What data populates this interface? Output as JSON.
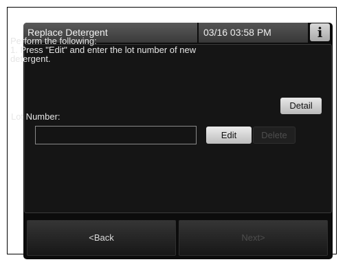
{
  "titlebar": {
    "title": "Replace Detergent",
    "datetime": "03/16 03:58 PM",
    "info_icon": "info-icon",
    "info_glyph": "i"
  },
  "instructions": {
    "text": "Perform the following:\n1. Press \"Edit\" and enter the lot number of new\ndetergent."
  },
  "buttons": {
    "detail": "Detail",
    "edit": "Edit",
    "delete": "Delete",
    "back": "<Back",
    "next": "Next>"
  },
  "lot": {
    "label": "Lot Number:",
    "value": ""
  },
  "colors": {
    "screen_bg": "#0c0c0c",
    "button_light": "#d8d8d8",
    "disabled_text": "#4e4e4e"
  }
}
